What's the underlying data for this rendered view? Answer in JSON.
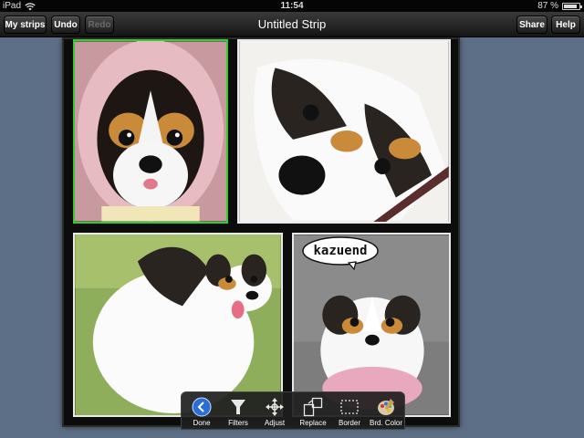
{
  "status_bar": {
    "device": "iPad",
    "time": "11:54",
    "battery": "87 %",
    "battery_level": 0.87
  },
  "toolbar": {
    "my_strips": "My strips",
    "undo": "Undo",
    "redo": "Redo",
    "title": "Untitled Strip",
    "share": "Share",
    "help": "Help"
  },
  "strip": {
    "speech_bubble": "kazuend"
  },
  "tools": [
    {
      "label": "Done",
      "icon": "back-arrow-icon"
    },
    {
      "label": "Filters",
      "icon": "filter-icon"
    },
    {
      "label": "Adjust",
      "icon": "move-arrows-icon"
    },
    {
      "label": "Replace",
      "icon": "replace-photo-icon"
    },
    {
      "label": "Border",
      "icon": "border-icon"
    },
    {
      "label": "Brd. Color",
      "icon": "palette-icon"
    }
  ],
  "colors": {
    "background": "#5d6f86",
    "selected_border": "#33cc33",
    "done_button": "#2a6fd6"
  }
}
